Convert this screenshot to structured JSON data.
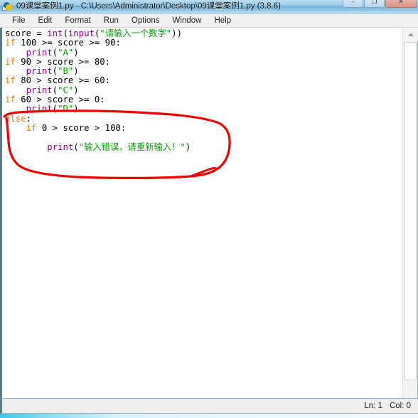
{
  "window": {
    "title": "09课堂案例1.py - C:\\Users\\Administrator\\Desktop\\09课堂案例1.py (3.8.6)",
    "app_icon": "python-idle-icon",
    "controls": {
      "minimize": "–",
      "maximize": "❐",
      "close": "✕"
    }
  },
  "menubar": {
    "items": [
      {
        "label": "File"
      },
      {
        "label": "Edit"
      },
      {
        "label": "Format"
      },
      {
        "label": "Run"
      },
      {
        "label": "Options"
      },
      {
        "label": "Window"
      },
      {
        "label": "Help"
      }
    ]
  },
  "editor": {
    "lines": [
      {
        "indent": 0,
        "tokens": [
          {
            "t": "score = ",
            "c": "pun"
          },
          {
            "t": "int",
            "c": "bi"
          },
          {
            "t": "(",
            "c": "pun"
          },
          {
            "t": "input",
            "c": "bi"
          },
          {
            "t": "(",
            "c": "pun"
          },
          {
            "t": "\"请输入一个数字\"",
            "c": "str"
          },
          {
            "t": "))",
            "c": "pun"
          }
        ]
      },
      {
        "indent": 0,
        "tokens": [
          {
            "t": "if",
            "c": "kw"
          },
          {
            "t": " 100 >= score >= 90:",
            "c": "pun"
          }
        ]
      },
      {
        "indent": 0,
        "tokens": [
          {
            "t": "    ",
            "c": "pun"
          },
          {
            "t": "print",
            "c": "bi"
          },
          {
            "t": "(",
            "c": "pun"
          },
          {
            "t": "\"A\"",
            "c": "str"
          },
          {
            "t": ")",
            "c": "pun"
          }
        ]
      },
      {
        "indent": 0,
        "tokens": [
          {
            "t": "if",
            "c": "kw"
          },
          {
            "t": " 90 > score >= 80:",
            "c": "pun"
          }
        ]
      },
      {
        "indent": 0,
        "tokens": [
          {
            "t": "    ",
            "c": "pun"
          },
          {
            "t": "print",
            "c": "bi"
          },
          {
            "t": "(",
            "c": "pun"
          },
          {
            "t": "\"B\"",
            "c": "str"
          },
          {
            "t": ")",
            "c": "pun"
          }
        ]
      },
      {
        "indent": 0,
        "tokens": [
          {
            "t": "if",
            "c": "kw"
          },
          {
            "t": " 80 > score >= 60:",
            "c": "pun"
          }
        ]
      },
      {
        "indent": 0,
        "tokens": [
          {
            "t": "    ",
            "c": "pun"
          },
          {
            "t": "print",
            "c": "bi"
          },
          {
            "t": "(",
            "c": "pun"
          },
          {
            "t": "\"C\"",
            "c": "str"
          },
          {
            "t": ")",
            "c": "pun"
          }
        ]
      },
      {
        "indent": 0,
        "tokens": [
          {
            "t": "if",
            "c": "kw"
          },
          {
            "t": " 60 > score >= 0:",
            "c": "pun"
          }
        ]
      },
      {
        "indent": 0,
        "tokens": [
          {
            "t": "    ",
            "c": "pun"
          },
          {
            "t": "print",
            "c": "bi"
          },
          {
            "t": "(",
            "c": "pun"
          },
          {
            "t": "\"D\"",
            "c": "str"
          },
          {
            "t": ")",
            "c": "pun"
          }
        ]
      },
      {
        "indent": 0,
        "tokens": [
          {
            "t": "else",
            "c": "kw"
          },
          {
            "t": ":",
            "c": "pun"
          }
        ]
      },
      {
        "indent": 0,
        "tokens": [
          {
            "t": "    ",
            "c": "pun"
          },
          {
            "t": "if",
            "c": "kw"
          },
          {
            "t": " 0 > score > 100:",
            "c": "pun"
          }
        ]
      },
      {
        "indent": 0,
        "tokens": []
      },
      {
        "indent": 0,
        "tokens": [
          {
            "t": "        ",
            "c": "pun"
          },
          {
            "t": "print",
            "c": "bi"
          },
          {
            "t": "(",
            "c": "pun"
          },
          {
            "t": "\"输入错误，请重新输入！\"",
            "c": "str"
          },
          {
            "t": ")",
            "c": "pun"
          }
        ]
      }
    ],
    "syntax_colors": {
      "keyword": "#ff7700",
      "builtin": "#900090",
      "string": "#00a000",
      "plain": "#000000",
      "background": "#ffffff"
    }
  },
  "annotation": {
    "kind": "hand-drawn-ellipse",
    "color": "#f00000",
    "encircles": "else-block"
  },
  "scrollbar": {
    "up_arrow": "scroll-up-icon",
    "down_arrow": "scroll-down-icon"
  },
  "statusbar": {
    "line_label": "Ln: 1",
    "col_label": "Col: 0"
  }
}
